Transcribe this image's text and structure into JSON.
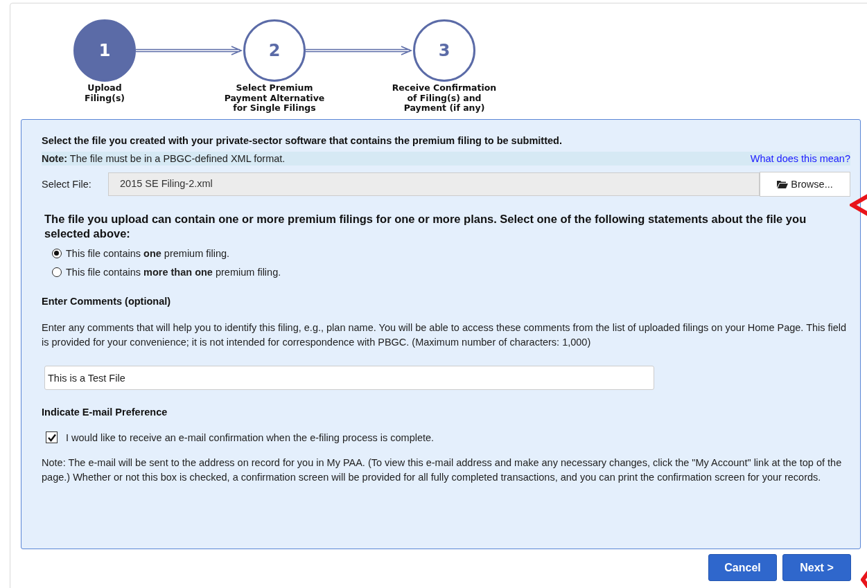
{
  "steps": [
    {
      "number": "1",
      "label": [
        "Upload",
        "Filing(s)"
      ],
      "selected": true
    },
    {
      "number": "2",
      "label": [
        "Select Premium",
        "Payment Alternative",
        "for Single Filings"
      ],
      "selected": false
    },
    {
      "number": "3",
      "label": [
        "Receive Confirmation",
        "of Filing(s) and",
        "Payment (if any)"
      ],
      "selected": false
    }
  ],
  "instruction": "Select the file you created with your private-sector software that contains the premium filing to be submitted.",
  "note": {
    "text": "**Note:** The file must be in a PBGC-defined XML format.",
    "link": "What does this mean?"
  },
  "file_select": {
    "label": "Select File:",
    "value": "2015 SE Filing-2.xml",
    "button": "Browse..."
  },
  "question": "The file you upload can contain one or more premium filings for one or more plans.  Select one of the following statements about the file you selected above:",
  "options": [
    {
      "label": "This file contains **one** premium filing.",
      "selected": true
    },
    {
      "label": "This file contains **more than one** premium filing.",
      "selected": false
    }
  ],
  "comments": {
    "heading": "Enter Comments (optional)",
    "description": "Enter any comments that will help you to identify this filing, e.g., plan name. You will be able to access these comments from the list of uploaded filings on your Home Page. This field is provided for your convenience; it is not intended for correspondence with PBGC. (Maximum number of characters: 1,000)",
    "value": "This is a Test File"
  },
  "email": {
    "heading": "Indicate E-mail Preference",
    "label": "I would like to receive an e-mail confirmation when the e-filing process is complete.",
    "checked": true,
    "note": "Note: The e-mail will be sent to the address on record for you in My PAA. (To view this e-mail address and make any necessary changes, click the \"My Account\" link at the top of the page.) Whether or not this box is checked, a confirmation screen will be provided for all fully completed transactions, and you can print the confirmation screen for your records."
  },
  "buttons": [
    "Cancel",
    "Next >"
  ]
}
